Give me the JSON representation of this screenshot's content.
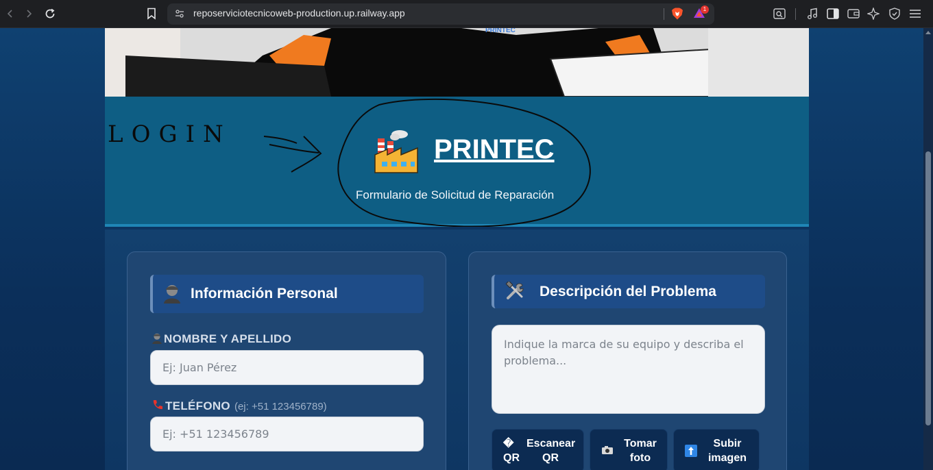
{
  "browser": {
    "url": "reposerviciotecnicoweb-production.up.railway.app",
    "rewards_count": "1"
  },
  "header": {
    "brand": "PRINTEC",
    "subtitle": "Formulario de Solicitud de Reparación",
    "annotation": "LOGIN"
  },
  "personal": {
    "title": "Información Personal",
    "name_label": "NOMBRE Y APELLIDO",
    "name_placeholder": "Ej: Juan Pérez",
    "phone_label": "TELÉFONO",
    "phone_hint": "(ej: +51 123456789)",
    "phone_placeholder": "Ej: +51 123456789"
  },
  "problem": {
    "title": "Descripción del Problema",
    "description_placeholder": "Indique la marca de su equipo y describa el problema...",
    "scan_icon": "�",
    "scan_qr_1": "Escanear",
    "scan_qr_2": "QR",
    "scan_qr_side": "QR",
    "take_photo_1": "Tomar",
    "take_photo_2": "foto",
    "upload_1": "Subir",
    "upload_2": "imagen"
  },
  "colors": {
    "header_bg": "#0e5e84",
    "card_bg": "#1f4672",
    "section_head_bg": "#1e4c88",
    "button_bg": "#0c2b52"
  }
}
